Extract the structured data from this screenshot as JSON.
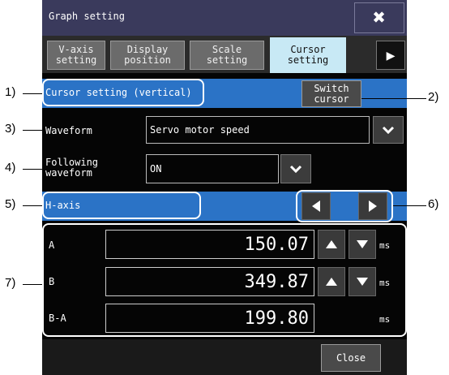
{
  "window": {
    "title": "Graph setting"
  },
  "tabs": [
    {
      "label_line1": "V-axis",
      "label_line2": "setting",
      "active": false
    },
    {
      "label_line1": "Display",
      "label_line2": "position",
      "active": false
    },
    {
      "label_line1": "Scale",
      "label_line2": "setting",
      "active": false
    },
    {
      "label_line1": "Cursor",
      "label_line2": "setting",
      "active": true
    }
  ],
  "cursor_section": {
    "label": "Cursor setting (vertical)",
    "switch_line1": "Switch",
    "switch_line2": "cursor"
  },
  "waveform": {
    "label": "Waveform",
    "value": "Servo motor speed"
  },
  "following": {
    "label_line1": "Following",
    "label_line2": "waveform",
    "value": "ON"
  },
  "h_axis": {
    "label": "H-axis"
  },
  "cursor_values": [
    {
      "name": "A",
      "value": "150.07",
      "unit": "ms"
    },
    {
      "name": "B",
      "value": "349.87",
      "unit": "ms"
    },
    {
      "name": "B-A",
      "value": "199.80",
      "unit": "ms"
    }
  ],
  "footer": {
    "close_label": "Close"
  },
  "callouts": {
    "c1": "1)",
    "c2": "2)",
    "c3": "3)",
    "c4": "4)",
    "c5": "5)",
    "c6": "6)",
    "c7": "7)"
  },
  "colors": {
    "section_bar": "#2b73c6",
    "active_tab": "#c8e9f5",
    "title_bar": "#3a3a5c"
  }
}
